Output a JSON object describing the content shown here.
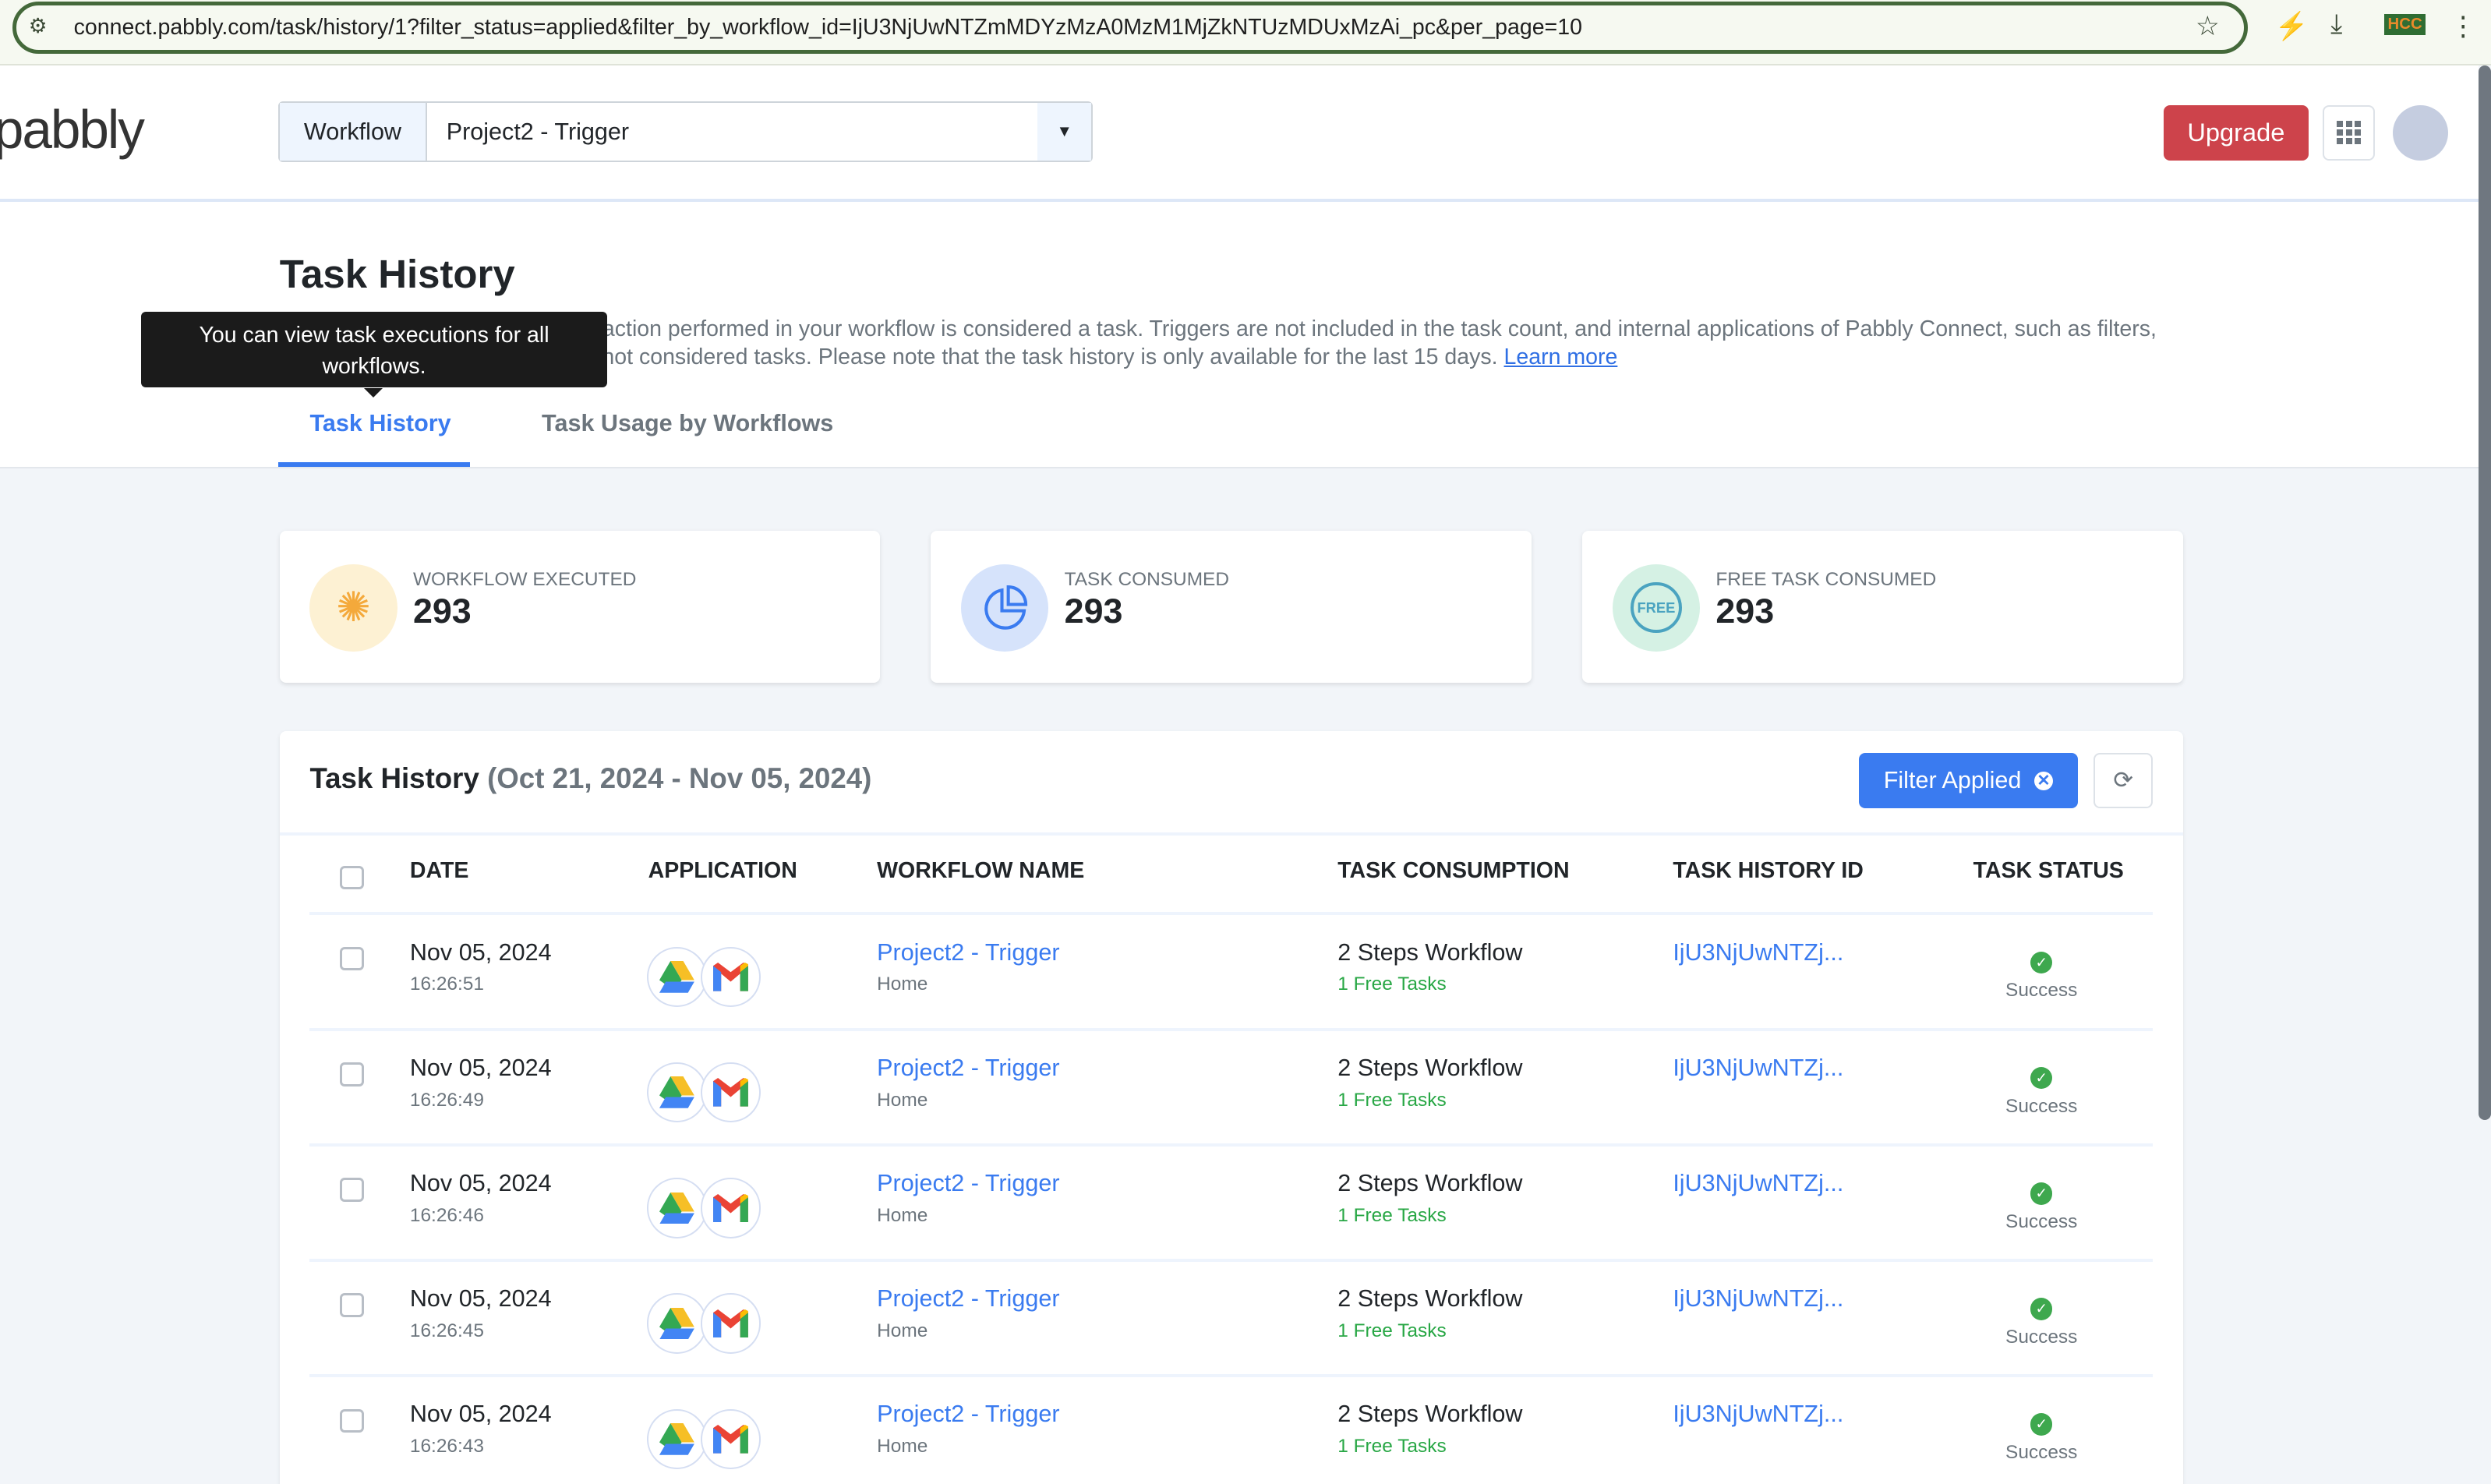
{
  "browser": {
    "url": "connect.pabbly.com/task/history/1?filter_status=applied&filter_by_workflow_id=IjU3NjUwNTZmMDYzMzA0MzM1MjZkNTUzMDUxMzAi_pc&per_page=10",
    "extension_label": "HCC"
  },
  "header": {
    "logo": "pabbly",
    "workflow_label": "Workflow",
    "workflow_value": "Project2 - Trigger",
    "upgrade": "Upgrade"
  },
  "page": {
    "title": "Task History",
    "description": "View all of your task history. Any action performed in your workflow is considered a task. Triggers are not included in the task count, and internal applications of Pabbly Connect, such as filters, routers, and formatters, are also not considered tasks. Please note that the task history is only available for the last 15 days.",
    "learn_more": "Learn more",
    "tooltip": "You can view task executions for all workflows.",
    "tabs": [
      "Task History",
      "Task Usage by Workflows"
    ]
  },
  "stats": [
    {
      "label": "WORKFLOW EXECUTED",
      "value": "293",
      "color": "#f4a93b"
    },
    {
      "label": "TASK CONSUMED",
      "value": "293",
      "color": "#3a7bf0"
    },
    {
      "label": "FREE TASK CONSUMED",
      "value": "293",
      "color": "#4aa3c0"
    }
  ],
  "table": {
    "title": "Task History",
    "range": "(Oct 21, 2024 - Nov 05, 2024)",
    "filter": "Filter Applied",
    "columns": [
      "DATE",
      "APPLICATION",
      "WORKFLOW NAME",
      "TASK CONSUMPTION",
      "TASK HISTORY ID",
      "TASK STATUS"
    ],
    "rows": [
      {
        "date": "Nov 05, 2024",
        "time": "16:26:51",
        "apps": [
          "google-drive",
          "gmail"
        ],
        "workflow": "Project2 - Trigger",
        "folder": "Home",
        "consumption": "2 Steps Workflow",
        "free": "1 Free Tasks",
        "id": "IjU3NjUwNTZj...",
        "status": "Success"
      },
      {
        "date": "Nov 05, 2024",
        "time": "16:26:49",
        "apps": [
          "google-drive",
          "gmail"
        ],
        "workflow": "Project2 - Trigger",
        "folder": "Home",
        "consumption": "2 Steps Workflow",
        "free": "1 Free Tasks",
        "id": "IjU3NjUwNTZj...",
        "status": "Success"
      },
      {
        "date": "Nov 05, 2024",
        "time": "16:26:46",
        "apps": [
          "google-drive",
          "gmail"
        ],
        "workflow": "Project2 - Trigger",
        "folder": "Home",
        "consumption": "2 Steps Workflow",
        "free": "1 Free Tasks",
        "id": "IjU3NjUwNTZj...",
        "status": "Success"
      },
      {
        "date": "Nov 05, 2024",
        "time": "16:26:45",
        "apps": [
          "google-drive",
          "gmail"
        ],
        "workflow": "Project2 - Trigger",
        "folder": "Home",
        "consumption": "2 Steps Workflow",
        "free": "1 Free Tasks",
        "id": "IjU3NjUwNTZj...",
        "status": "Success"
      },
      {
        "date": "Nov 05, 2024",
        "time": "16:26:43",
        "apps": [
          "google-drive",
          "gmail"
        ],
        "workflow": "Project2 - Trigger",
        "folder": "Home",
        "consumption": "2 Steps Workflow",
        "free": "1 Free Tasks",
        "id": "IjU3NjUwNTZj...",
        "status": "Success"
      }
    ]
  }
}
